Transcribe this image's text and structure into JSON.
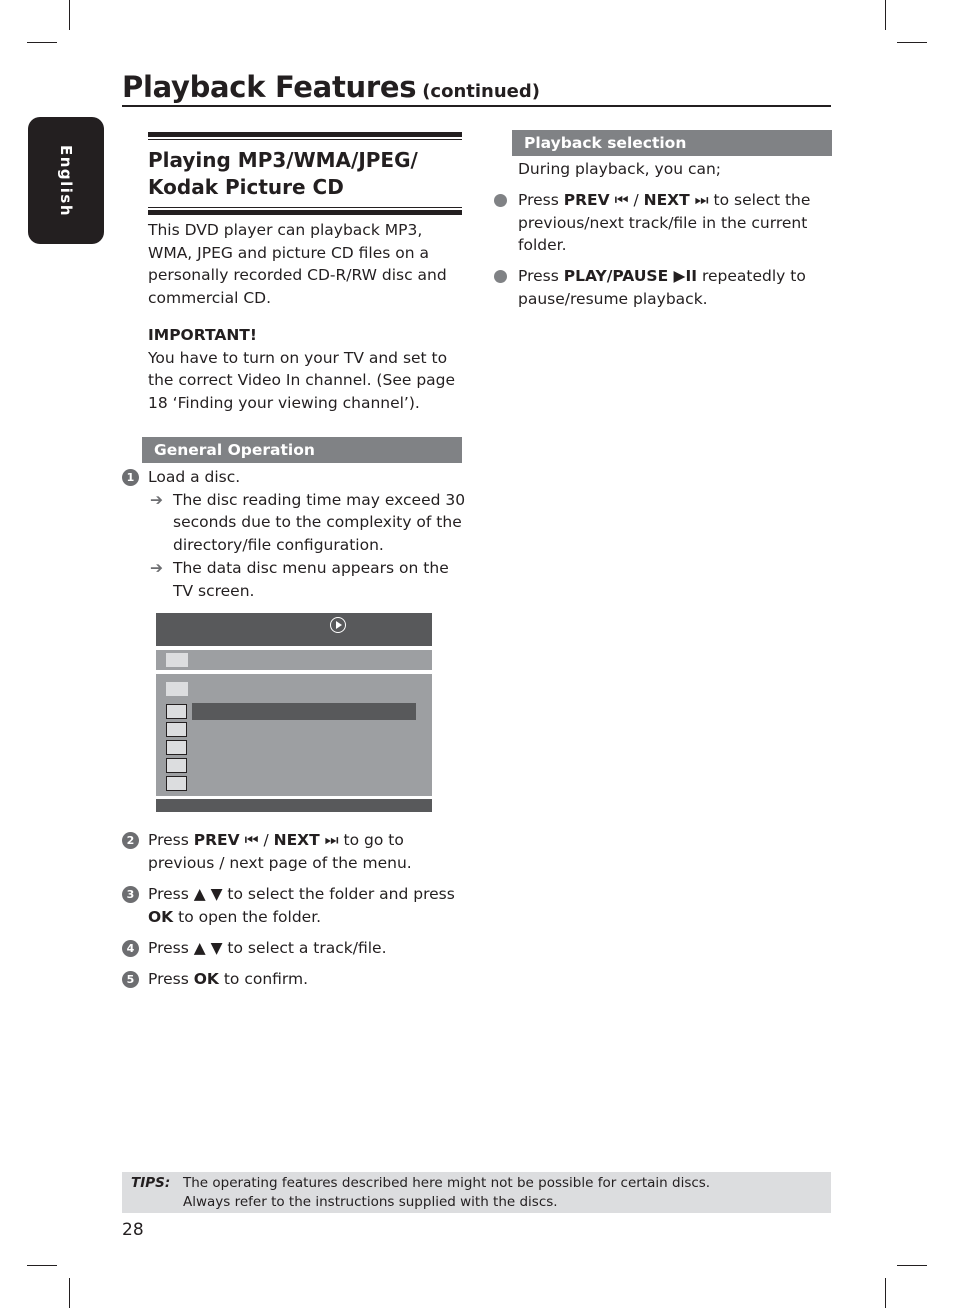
{
  "page": {
    "title": "Playback Features",
    "title_suffix": "(continued)",
    "language_tab": "English",
    "page_number": "28"
  },
  "left_column": {
    "section_title_line1": "Playing MP3/WMA/JPEG/",
    "section_title_line2": "Kodak Picture CD",
    "intro": "This DVD player can playback MP3, WMA, JPEG and picture CD files on a personally recorded CD-R/RW disc and commercial CD.",
    "important_label": "IMPORTANT!",
    "important_text": "You have to turn on your TV and set to the correct Video In channel.  (See page 18 ‘Finding your viewing channel’).",
    "general_operation_header": "General Operation",
    "steps": [
      {
        "num": "1",
        "text": "Load a disc.",
        "subs": [
          "The disc reading time may exceed 30 seconds due to the complexity of the directory/file configuration.",
          "The data disc menu appears on the TV screen."
        ]
      },
      {
        "num": "2",
        "pre": "Press ",
        "b1": "PREV",
        "icon1": "⏮",
        "mid": " / ",
        "b2": "NEXT",
        "icon2": "⏭",
        "post": " to go to previous / next page of the menu."
      },
      {
        "num": "3",
        "pre": "Press ▲ ▼ to select the folder and press ",
        "b1": "OK",
        "post": " to open the folder."
      },
      {
        "num": "4",
        "pre": "Press ▲ ▼ to select a track/file."
      },
      {
        "num": "5",
        "pre": "Press ",
        "b1": "OK",
        "post": " to confirm."
      }
    ],
    "arrow_glyph": "➔"
  },
  "disc_menu_screen": {
    "header_icon": "play-circle-icon",
    "rows": [
      "folder",
      "folder",
      "file-selected",
      "file",
      "file",
      "file",
      "file"
    ]
  },
  "right_column": {
    "header": "Playback selection",
    "intro": "During playback, you can;",
    "bullets": [
      {
        "pre": "Press ",
        "b1": "PREV",
        "icon1": "⏮",
        "mid": " / ",
        "b2": "NEXT",
        "icon2": "⏭",
        "post": " to select the previous/next track/file in the current folder."
      },
      {
        "pre": "Press ",
        "b1": "PLAY/PAUSE ▶II",
        "post": " repeatedly to pause/resume playback."
      }
    ]
  },
  "tips": {
    "label": "TIPS:",
    "line1": "The operating features described here might not be possible for certain discs.",
    "line2": "Always refer to the instructions supplied with the discs."
  }
}
